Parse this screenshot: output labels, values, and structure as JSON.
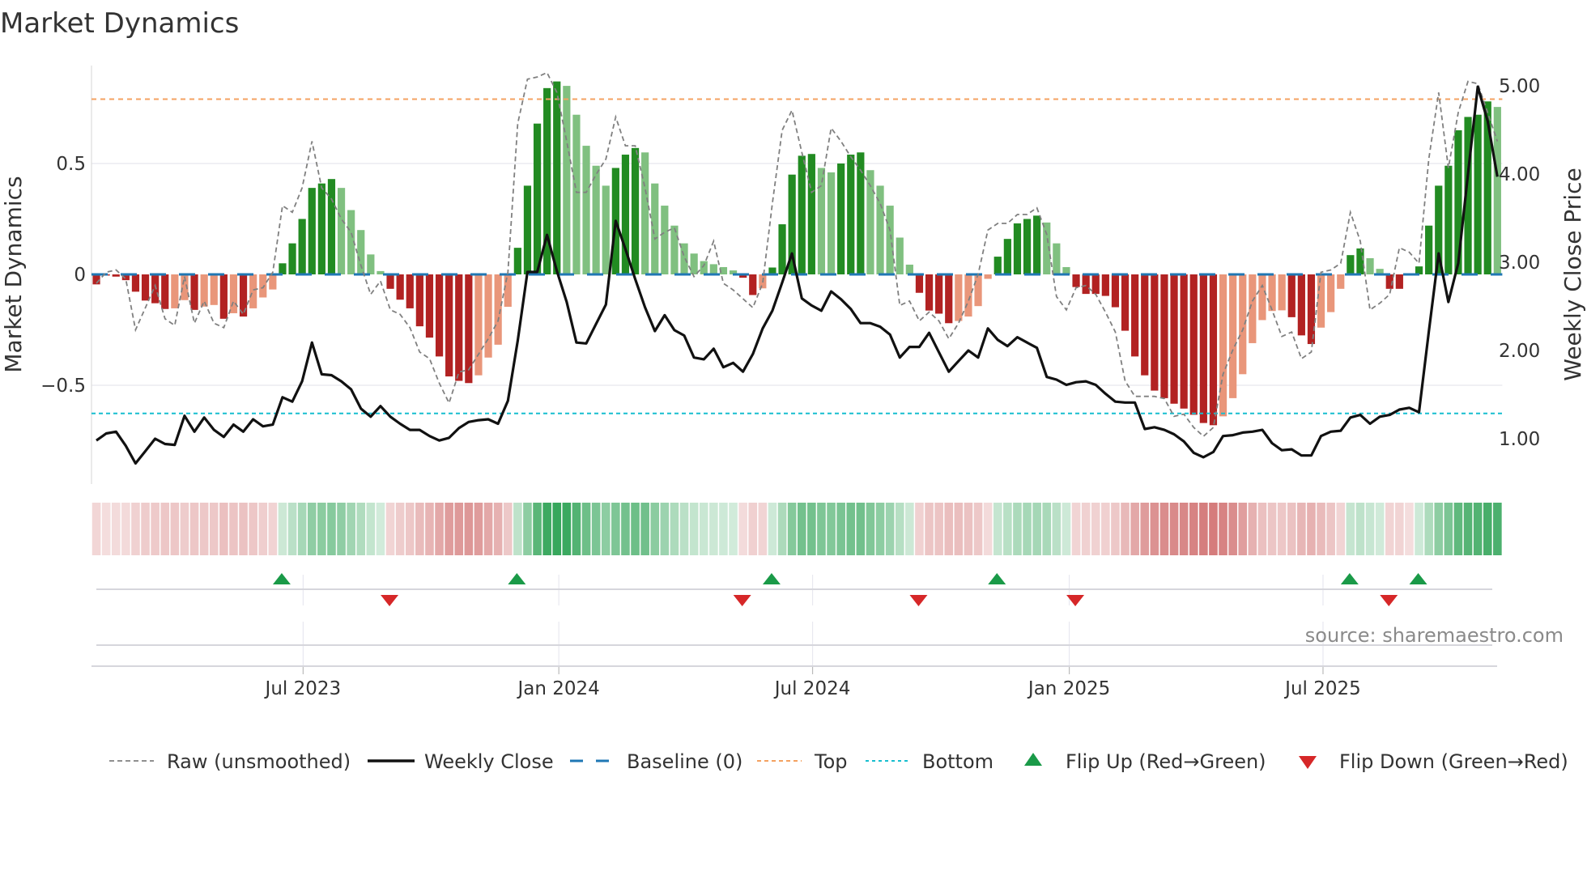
{
  "title": "Market Dynamics",
  "source": "source: sharemaestro.com",
  "colors": {
    "up_strong": "#228b22",
    "up_fading": "#80c080",
    "down_strong": "#b22222",
    "down_fading": "#e9967a",
    "baseline": "#1f77b4",
    "top": "#f4a261",
    "bottom": "#17becf",
    "raw": "#808080",
    "close": "#111111",
    "flip_up": "#1a9a48",
    "flip_down": "#d62728"
  },
  "chart_data": {
    "type": "bar+line",
    "title": "Market Dynamics",
    "ylabel": "Market Dynamics",
    "y2label": "Weekly Close Price",
    "ylim": [
      -0.94,
      0.95
    ],
    "y2lim": [
      0.49,
      5.23
    ],
    "yticks": [
      {
        "v": 0.5,
        "label": "0.5"
      },
      {
        "v": 0,
        "label": "0"
      },
      {
        "v": -0.5,
        "label": "−0.5"
      }
    ],
    "y2ticks": [
      {
        "v": 5,
        "label": "5.00"
      },
      {
        "v": 4,
        "label": "4.00"
      },
      {
        "v": 3,
        "label": "3.00"
      },
      {
        "v": 2,
        "label": "2.00"
      },
      {
        "v": 1,
        "label": "1.00"
      }
    ],
    "xticks": [
      {
        "week": 21.1,
        "label": "Jul 2023"
      },
      {
        "week": 47.2,
        "label": "Jan 2024"
      },
      {
        "week": 73.1,
        "label": "Jul 2024"
      },
      {
        "week": 99.3,
        "label": "Jan 2025"
      },
      {
        "week": 125.2,
        "label": "Jul 2025"
      }
    ],
    "top_level": 0.79,
    "bottom_level": -0.627,
    "baseline": 0,
    "dynamics": [
      -0.045,
      -0.005,
      -0.01,
      -0.026,
      -0.078,
      -0.118,
      -0.13,
      -0.156,
      -0.153,
      -0.116,
      -0.16,
      -0.145,
      -0.138,
      -0.2,
      -0.175,
      -0.19,
      -0.153,
      -0.104,
      -0.068,
      0.05,
      0.14,
      0.25,
      0.39,
      0.41,
      0.43,
      0.39,
      0.29,
      0.2,
      0.09,
      0.015,
      -0.065,
      -0.114,
      -0.153,
      -0.234,
      -0.285,
      -0.37,
      -0.46,
      -0.48,
      -0.49,
      -0.455,
      -0.375,
      -0.317,
      -0.146,
      0.12,
      0.4,
      0.68,
      0.84,
      0.87,
      0.85,
      0.72,
      0.58,
      0.49,
      0.4,
      0.48,
      0.54,
      0.57,
      0.55,
      0.41,
      0.31,
      0.22,
      0.14,
      0.094,
      0.06,
      0.046,
      0.033,
      0.018,
      -0.015,
      -0.093,
      -0.063,
      0.031,
      0.226,
      0.45,
      0.535,
      0.543,
      0.48,
      0.46,
      0.5,
      0.54,
      0.55,
      0.47,
      0.4,
      0.31,
      0.166,
      0.044,
      -0.083,
      -0.163,
      -0.177,
      -0.22,
      -0.21,
      -0.19,
      -0.143,
      -0.02,
      0.08,
      0.16,
      0.23,
      0.25,
      0.265,
      0.234,
      0.14,
      0.033,
      -0.057,
      -0.088,
      -0.088,
      -0.097,
      -0.148,
      -0.254,
      -0.37,
      -0.455,
      -0.524,
      -0.558,
      -0.583,
      -0.605,
      -0.633,
      -0.67,
      -0.68,
      -0.64,
      -0.558,
      -0.45,
      -0.31,
      -0.206,
      -0.165,
      -0.162,
      -0.193,
      -0.275,
      -0.314,
      -0.24,
      -0.17,
      -0.065,
      0.087,
      0.117,
      0.073,
      0.025,
      -0.065,
      -0.065,
      -0.003,
      0.036,
      0.22,
      0.4,
      0.49,
      0.65,
      0.71,
      0.72,
      0.78,
      0.755
    ],
    "state": "RRRRRRRRrrRrrRrRrrrGGGGGGgggggRRRRRRRRRrrrrGGGGGgggggGGGggggggggggRRrGGGGGggGGGgggggRRRRrrrrGGGGGgggRRRRRRRRRRRRRRRrrrrrrrRRRrrrGGggRRrGGGGGGGGg",
    "raw": [
      -0.04,
      0.01,
      0.02,
      -0.02,
      -0.25,
      -0.15,
      -0.05,
      -0.2,
      -0.23,
      -0.01,
      -0.22,
      -0.12,
      -0.22,
      -0.24,
      -0.12,
      -0.18,
      -0.07,
      -0.06,
      0.01,
      0.31,
      0.28,
      0.39,
      0.6,
      0.39,
      0.34,
      0.25,
      0.19,
      0.04,
      -0.09,
      -0.03,
      -0.16,
      -0.18,
      -0.24,
      -0.35,
      -0.38,
      -0.49,
      -0.58,
      -0.44,
      -0.43,
      -0.36,
      -0.29,
      -0.21,
      0.01,
      0.68,
      0.88,
      0.89,
      0.91,
      0.82,
      0.6,
      0.37,
      0.37,
      0.45,
      0.52,
      0.71,
      0.58,
      0.58,
      0.39,
      0.16,
      0.19,
      0.21,
      0.08,
      -0.01,
      0.04,
      0.15,
      -0.04,
      -0.07,
      -0.11,
      -0.15,
      -0.04,
      0.32,
      0.65,
      0.74,
      0.55,
      0.37,
      0.4,
      0.66,
      0.6,
      0.53,
      0.47,
      0.4,
      0.32,
      0.2,
      -0.14,
      -0.12,
      -0.21,
      -0.17,
      -0.21,
      -0.29,
      -0.22,
      -0.12,
      0.0,
      0.2,
      0.23,
      0.23,
      0.27,
      0.27,
      0.3,
      0.18,
      -0.1,
      -0.16,
      -0.06,
      -0.05,
      -0.09,
      -0.17,
      -0.26,
      -0.48,
      -0.55,
      -0.55,
      -0.55,
      -0.56,
      -0.64,
      -0.63,
      -0.69,
      -0.73,
      -0.69,
      -0.45,
      -0.34,
      -0.25,
      -0.12,
      -0.05,
      -0.16,
      -0.28,
      -0.26,
      -0.38,
      -0.35,
      0.01,
      0.02,
      0.05,
      0.28,
      0.15,
      -0.16,
      -0.13,
      -0.09,
      0.12,
      0.1,
      0.05,
      0.52,
      0.82,
      0.48,
      0.73,
      0.87,
      0.86,
      0.73,
      0.6
    ],
    "close": [
      0.98,
      1.06,
      1.08,
      0.92,
      0.72,
      0.86,
      1.0,
      0.94,
      0.93,
      1.26,
      1.08,
      1.24,
      1.1,
      1.02,
      1.16,
      1.08,
      1.22,
      1.14,
      1.16,
      1.47,
      1.42,
      1.65,
      2.09,
      1.73,
      1.72,
      1.65,
      1.56,
      1.34,
      1.25,
      1.37,
      1.25,
      1.17,
      1.1,
      1.1,
      1.03,
      0.98,
      1.01,
      1.12,
      1.19,
      1.21,
      1.22,
      1.17,
      1.43,
      2.11,
      2.89,
      2.89,
      3.31,
      2.9,
      2.55,
      2.09,
      2.08,
      2.3,
      2.52,
      3.47,
      3.15,
      2.81,
      2.49,
      2.22,
      2.4,
      2.23,
      2.17,
      1.92,
      1.9,
      2.02,
      1.81,
      1.86,
      1.76,
      1.96,
      2.25,
      2.45,
      2.77,
      3.1,
      2.59,
      2.51,
      2.45,
      2.67,
      2.58,
      2.47,
      2.31,
      2.31,
      2.27,
      2.18,
      1.92,
      2.04,
      2.04,
      2.2,
      1.98,
      1.76,
      1.88,
      2.0,
      1.92,
      2.25,
      2.12,
      2.05,
      2.15,
      2.09,
      2.03,
      1.7,
      1.67,
      1.61,
      1.64,
      1.65,
      1.61,
      1.51,
      1.42,
      1.41,
      1.41,
      1.11,
      1.13,
      1.1,
      1.05,
      0.97,
      0.84,
      0.79,
      0.85,
      1.03,
      1.04,
      1.07,
      1.08,
      1.1,
      0.95,
      0.87,
      0.88,
      0.81,
      0.81,
      1.03,
      1.08,
      1.09,
      1.24,
      1.27,
      1.17,
      1.25,
      1.27,
      1.33,
      1.35,
      1.3,
      2.21,
      3.1,
      2.55,
      2.99,
      4.0,
      4.99,
      4.6,
      3.97
    ],
    "flip_up_weeks": [
      19,
      43,
      69,
      92,
      128,
      135
    ],
    "flip_down_weeks": [
      30,
      66,
      84,
      100,
      132
    ],
    "legend": {
      "placement": "bottom",
      "raw": "Raw (unsmoothed)",
      "close": "Weekly Close",
      "baseline": "Baseline (0)",
      "top": "Top",
      "bottom": "Bottom",
      "flip_up": "Flip Up (Red→Green)",
      "flip_down": "Flip Down (Green→Red)"
    }
  }
}
